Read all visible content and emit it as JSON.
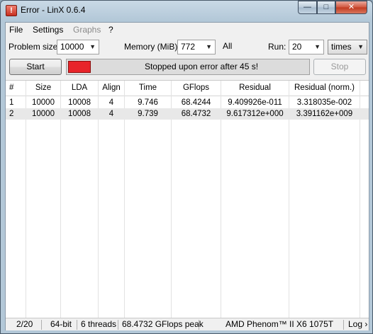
{
  "window": {
    "title": "Error - LinX 0.6.4",
    "icon": "app-warning-icon",
    "controls": {
      "minimize": "—",
      "maximize": "□",
      "close": "✕"
    }
  },
  "menu": {
    "file": "File",
    "settings": "Settings",
    "graphs": "Graphs",
    "help": "?"
  },
  "controls": {
    "problem_size_label": "Problem size:",
    "problem_size_value": "10000",
    "memory_label": "Memory (MiB):",
    "memory_value": "772",
    "all_label": "All",
    "run_label": "Run:",
    "run_value": "20",
    "run_unit": "times"
  },
  "actions": {
    "start": "Start",
    "stop": "Stop",
    "status_text": "Stopped upon error after 45 s!",
    "status_color": "#e8242a"
  },
  "table": {
    "columns": [
      "#",
      "Size",
      "LDA",
      "Align",
      "Time",
      "GFlops",
      "Residual",
      "Residual (norm.)"
    ],
    "rows": [
      [
        "1",
        "10000",
        "10008",
        "4",
        "9.746",
        "68.4244",
        "9.409926e-011",
        "3.318035e-002"
      ],
      [
        "2",
        "10000",
        "10008",
        "4",
        "9.739",
        "68.4732",
        "9.617312e+000",
        "3.391162e+009"
      ]
    ]
  },
  "statusbar": {
    "progress": "2/20",
    "bits": "64-bit",
    "threads": "6 threads",
    "peak": "68.4732 GFlops peak",
    "cpu": "AMD Phenom™ II X6 1075T",
    "log": "Log ›"
  }
}
